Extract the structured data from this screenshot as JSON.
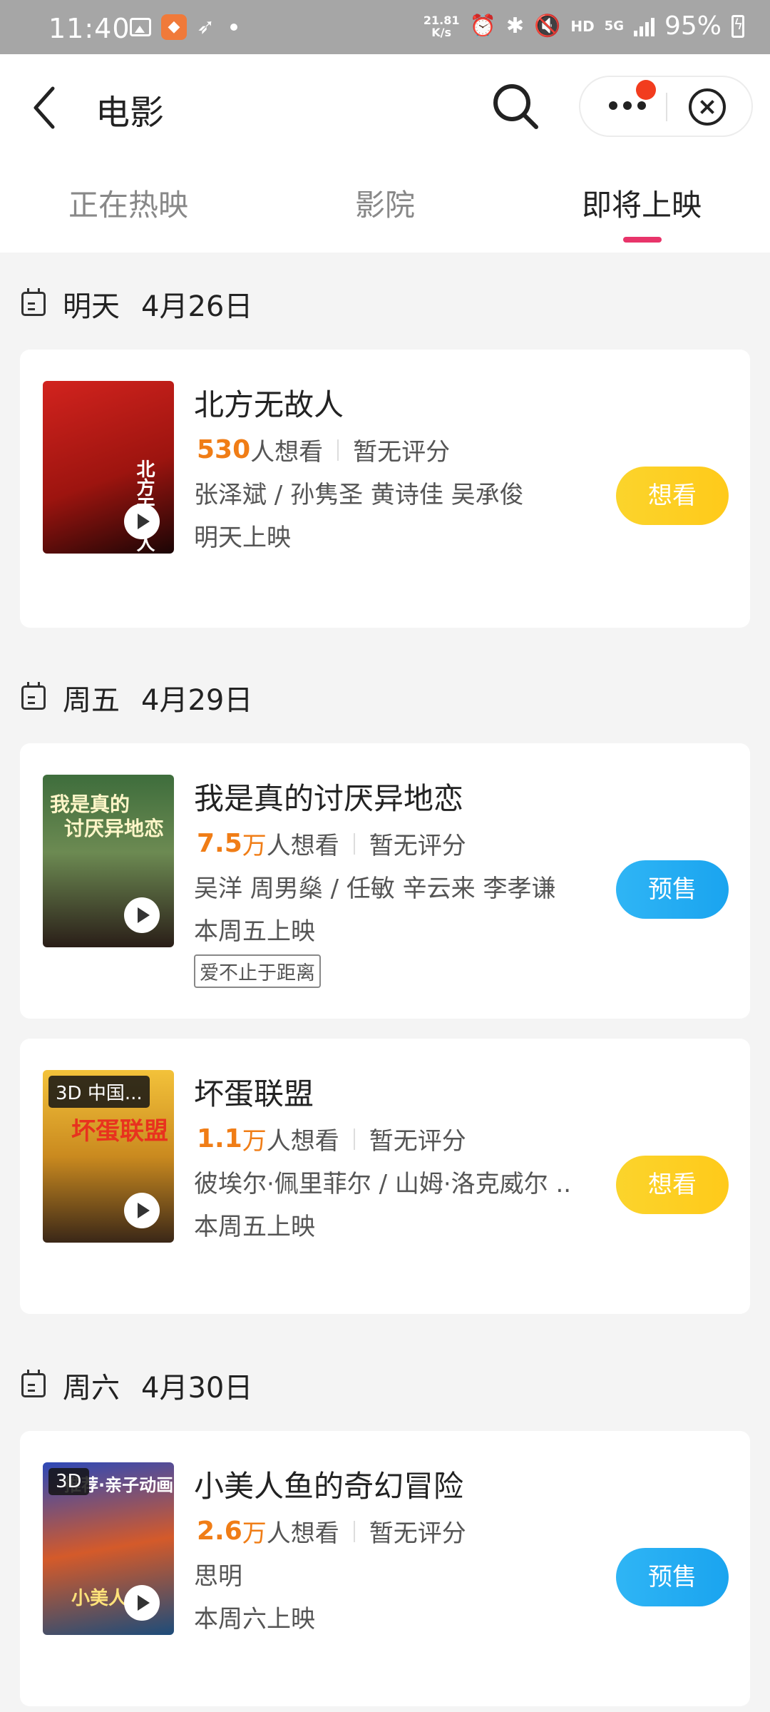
{
  "status_bar": {
    "time": "11:40",
    "speed": "21.81",
    "speed_unit": "K/s",
    "hd": "HD",
    "net": "5G",
    "battery": "95%"
  },
  "header": {
    "title": "电影",
    "tabs": [
      {
        "label": "正在热映",
        "active": false
      },
      {
        "label": "影院",
        "active": false
      },
      {
        "label": "即将上映",
        "active": true
      }
    ]
  },
  "sections": [
    {
      "day": "明天",
      "date": "4月26日",
      "movies": [
        {
          "title": "北方无故人",
          "want_num": "530",
          "want_unit": "",
          "want_suffix": "人想看",
          "rating": "暂无评分",
          "cast": "张泽斌 / 孙隽圣 黄诗佳 吴承俊",
          "release": "明天上映",
          "button": "想看"
        }
      ]
    },
    {
      "day": "周五",
      "date": "4月29日",
      "movies": [
        {
          "title": "我是真的讨厌异地恋",
          "want_num": "7.5",
          "want_unit": "万",
          "want_suffix": "人想看",
          "rating": "暂无评分",
          "cast": "吴洋 周男燊 / 任敏 辛云来 李孝谦",
          "release": "本周五上映",
          "tag": "爱不止于距离",
          "button": "预售"
        },
        {
          "title": "坏蛋联盟",
          "poster_badge": "3D 中国...",
          "want_num": "1.1",
          "want_unit": "万",
          "want_suffix": "人想看",
          "rating": "暂无评分",
          "cast": "彼埃尔·佩里菲尔 / 山姆·洛克威尔 ...",
          "release": "本周五上映",
          "button": "想看"
        }
      ]
    },
    {
      "day": "周六",
      "date": "4月30日",
      "movies": [
        {
          "title": "小美人鱼的奇幻冒险",
          "poster_badge": "3D",
          "want_num": "2.6",
          "want_unit": "万",
          "want_suffix": "人想看",
          "rating": "暂无评分",
          "cast": "思明",
          "release": "本周六上映",
          "button": "预售"
        }
      ]
    }
  ]
}
